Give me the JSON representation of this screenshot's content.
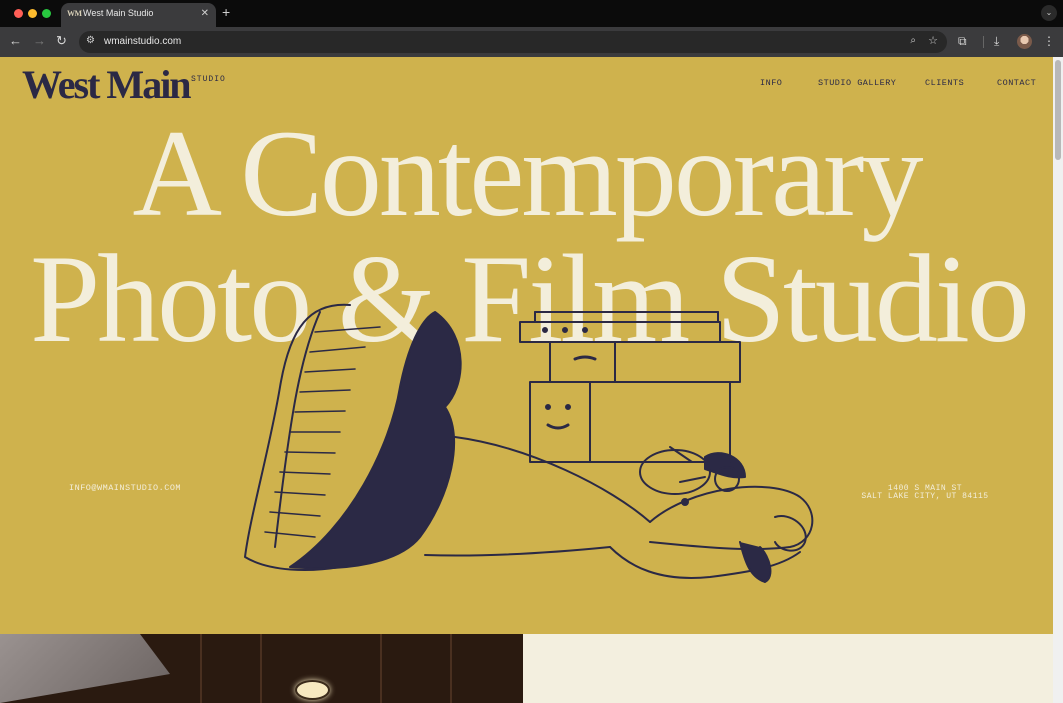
{
  "browser": {
    "tab_title": "West Main Studio",
    "tab_favicon": "WM",
    "tab_close_icon": "close-icon",
    "new_tab_icon": "plus-icon",
    "url": "wmainstudio.com",
    "icons": [
      "back-arrow-icon",
      "forward-arrow-icon",
      "reload-icon",
      "site-info-icon",
      "zoom-icon",
      "star-icon",
      "extensions-icon",
      "download-icon",
      "avatar",
      "menu-icon"
    ]
  },
  "site": {
    "logo": "West Main",
    "logo_sub": "STUDIO",
    "nav": [
      "INFO",
      "STUDIO GALLERY",
      "CLIENTS",
      "CONTACT"
    ],
    "hero_line1": "A Contemporary",
    "hero_line2": "Photo & Film Studio",
    "email": "INFO@WMAINSTUDIO.COM",
    "address_line1": "1400 S MAIN ST",
    "address_line2": "SALT LAKE CITY, UT 84115"
  },
  "colors": {
    "background": "#cfb24d",
    "ink": "#2b2945",
    "cream": "#f3eedb"
  }
}
